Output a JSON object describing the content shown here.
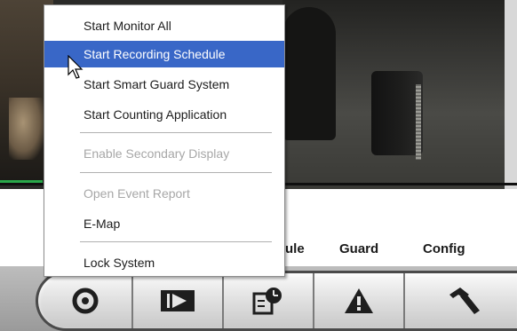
{
  "context_menu": {
    "items": [
      {
        "label": "Start Monitor All",
        "state": "normal"
      },
      {
        "label": "Start Recording Schedule",
        "state": "selected"
      },
      {
        "label": "Start Smart Guard System",
        "state": "normal"
      },
      {
        "label": "Start Counting Application",
        "state": "normal"
      },
      {
        "label": "Enable Secondary Display",
        "state": "disabled"
      },
      {
        "label": "Open Event Report",
        "state": "disabled"
      },
      {
        "label": "E-Map",
        "state": "normal"
      },
      {
        "label": "Lock System",
        "state": "normal"
      }
    ]
  },
  "tabs": {
    "schedule_partial": "ule",
    "guard": "Guard",
    "config": "Config"
  },
  "toolbar": {
    "buttons": [
      {
        "icon": "target-icon",
        "glyph": "◎"
      },
      {
        "icon": "playback-icon",
        "glyph": "▶"
      },
      {
        "icon": "schedule-icon",
        "glyph": "🗓"
      },
      {
        "icon": "warning-icon",
        "glyph": "⚠"
      },
      {
        "icon": "hammer-icon",
        "glyph": "🔨"
      }
    ]
  },
  "colors": {
    "menu_highlight": "#3967c7",
    "disabled_text": "#a7a7a7",
    "video_green_line": "#29a84a"
  }
}
